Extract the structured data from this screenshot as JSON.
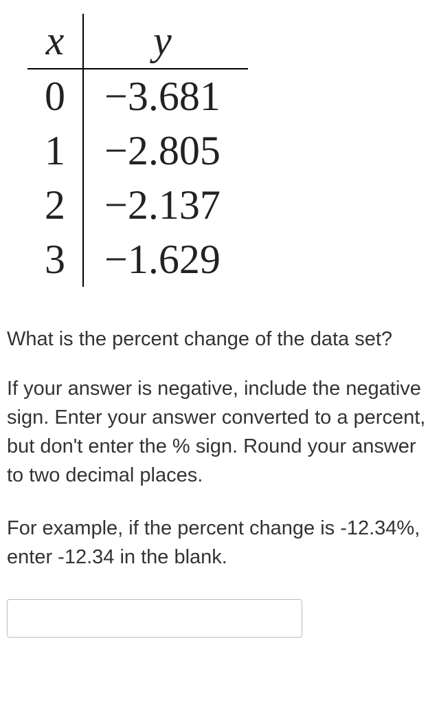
{
  "table": {
    "headers": {
      "x": "x",
      "y": "y"
    },
    "rows": [
      {
        "x": "0",
        "y": "−3.681"
      },
      {
        "x": "1",
        "y": "−2.805"
      },
      {
        "x": "2",
        "y": "−2.137"
      },
      {
        "x": "3",
        "y": "−1.629"
      }
    ]
  },
  "question": "What is the percent change of the data set?",
  "instructions": "If your answer is negative, include the negative sign. Enter your answer converted to a percent, but don't enter the % sign. Round your answer to two decimal places.",
  "example": "For example, if the percent change is -12.34%, enter -12.34 in the blank.",
  "chart_data": {
    "type": "table",
    "columns": [
      "x",
      "y"
    ],
    "rows": [
      [
        0,
        -3.681
      ],
      [
        1,
        -2.805
      ],
      [
        2,
        -2.137
      ],
      [
        3,
        -1.629
      ]
    ]
  }
}
